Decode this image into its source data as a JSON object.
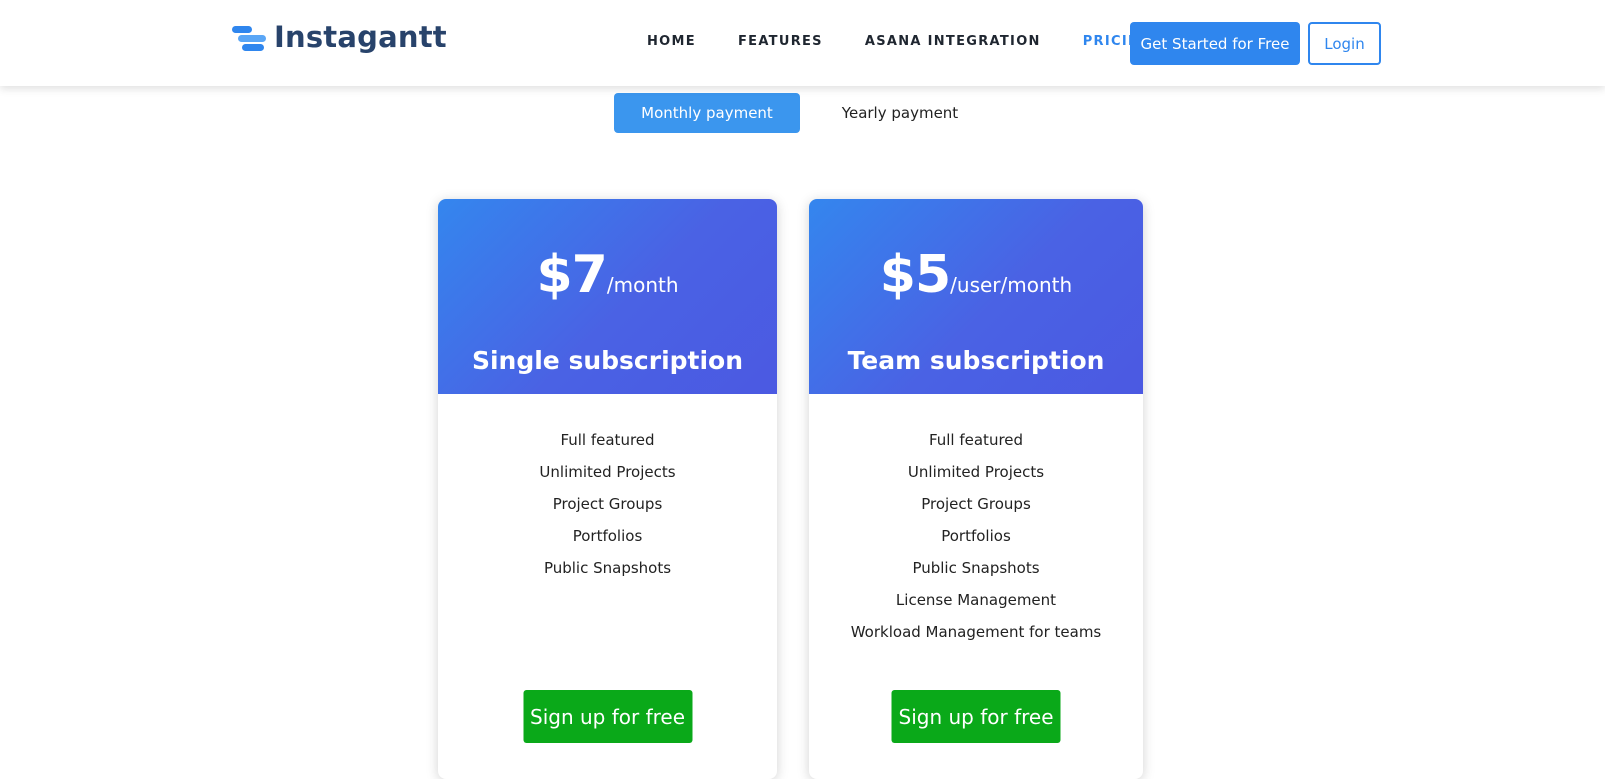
{
  "brand": {
    "name": "Instagantt"
  },
  "nav": {
    "items": [
      {
        "label": "HOME"
      },
      {
        "label": "FEATURES"
      },
      {
        "label": "ASANA INTEGRATION"
      },
      {
        "label": "PRICING"
      }
    ],
    "active": "PRICING",
    "cta_label": "Get Started for Free",
    "login_label": "Login"
  },
  "billing_toggle": {
    "monthly_label": "Monthly payment",
    "yearly_label": "Yearly payment",
    "selected": "monthly"
  },
  "plans": [
    {
      "price": "$7",
      "period": "/month",
      "name": "Single subscription",
      "features": [
        "Full featured",
        "Unlimited Projects",
        "Project Groups",
        "Portfolios",
        "Public Snapshots"
      ],
      "button_label": "Sign up for free"
    },
    {
      "price": "$5",
      "period": "/user/month",
      "name": "Team subscription",
      "features": [
        "Full featured",
        "Unlimited Projects",
        "Project Groups",
        "Portfolios",
        "Public Snapshots",
        "License Management",
        "Workload Management for teams"
      ],
      "button_label": "Sign up for free"
    }
  ],
  "colors": {
    "accent": "#2f86ee",
    "brand_text": "#28436b",
    "card_gradient_start": "#3486ee",
    "card_gradient_end": "#4b59e2",
    "signup_green": "#0aa919"
  }
}
